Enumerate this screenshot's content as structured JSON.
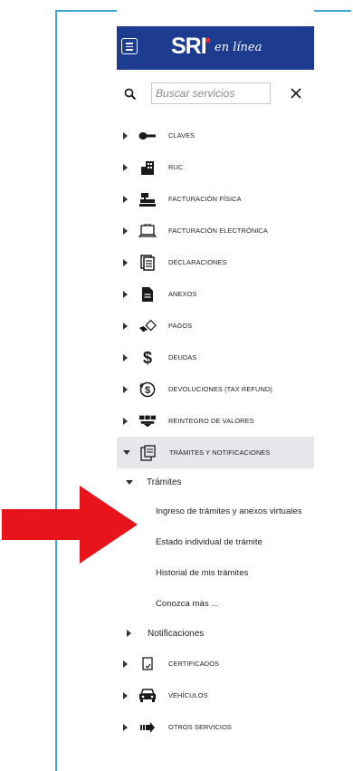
{
  "header": {
    "menu_icon": "hamburger-icon",
    "logo_main": "SRI",
    "logo_sub": "en línea"
  },
  "search": {
    "placeholder": "Buscar servicios",
    "value": "",
    "search_icon": "search-icon",
    "close_icon": "close-icon"
  },
  "menu": {
    "items": [
      {
        "label": "CLAVES",
        "icon": "key-icon"
      },
      {
        "label": "RUC",
        "icon": "building-icon"
      },
      {
        "label": "FACTURACIÓN FÍSICA",
        "icon": "cash-register-icon"
      },
      {
        "label": "FACTURACIÓN ELECTRÓNICA",
        "icon": "laptop-icon"
      },
      {
        "label": "DECLARACIONES",
        "icon": "documents-icon"
      },
      {
        "label": "ANEXOS",
        "icon": "file-icon"
      },
      {
        "label": "PAGOS",
        "icon": "hand-card-icon"
      },
      {
        "label": "DEUDAS",
        "icon": "dollar-icon"
      },
      {
        "label": "DEVOLUCIONES (TAX REFUND)",
        "icon": "dollar-circle-icon"
      },
      {
        "label": "REINTEGRO DE VALORES",
        "icon": "cash-icon"
      },
      {
        "label": "TRÁMITES Y NOTIFICACIONES",
        "icon": "notification-doc-icon"
      }
    ],
    "tramites": {
      "label": "Trámites",
      "links": [
        "Ingreso de trámites y anexos virtuales",
        "Estado individual de trámite",
        "Historial de mis trámites",
        "Conozca más ..."
      ]
    },
    "notificaciones": {
      "label": "Notificaciones"
    },
    "bottom_items": [
      {
        "label": "CERTIFICADOS",
        "icon": "certificate-icon"
      },
      {
        "label": "VEHÍCULOS",
        "icon": "car-icon"
      },
      {
        "label": "OTROS SERVICIOS",
        "icon": "arrow-right-icon"
      }
    ]
  },
  "colors": {
    "header_bg": "#1d3c8f",
    "frame_border": "#3aa6dd",
    "active_bg": "#e6e7ea",
    "annotation_arrow": "#e8141c"
  }
}
